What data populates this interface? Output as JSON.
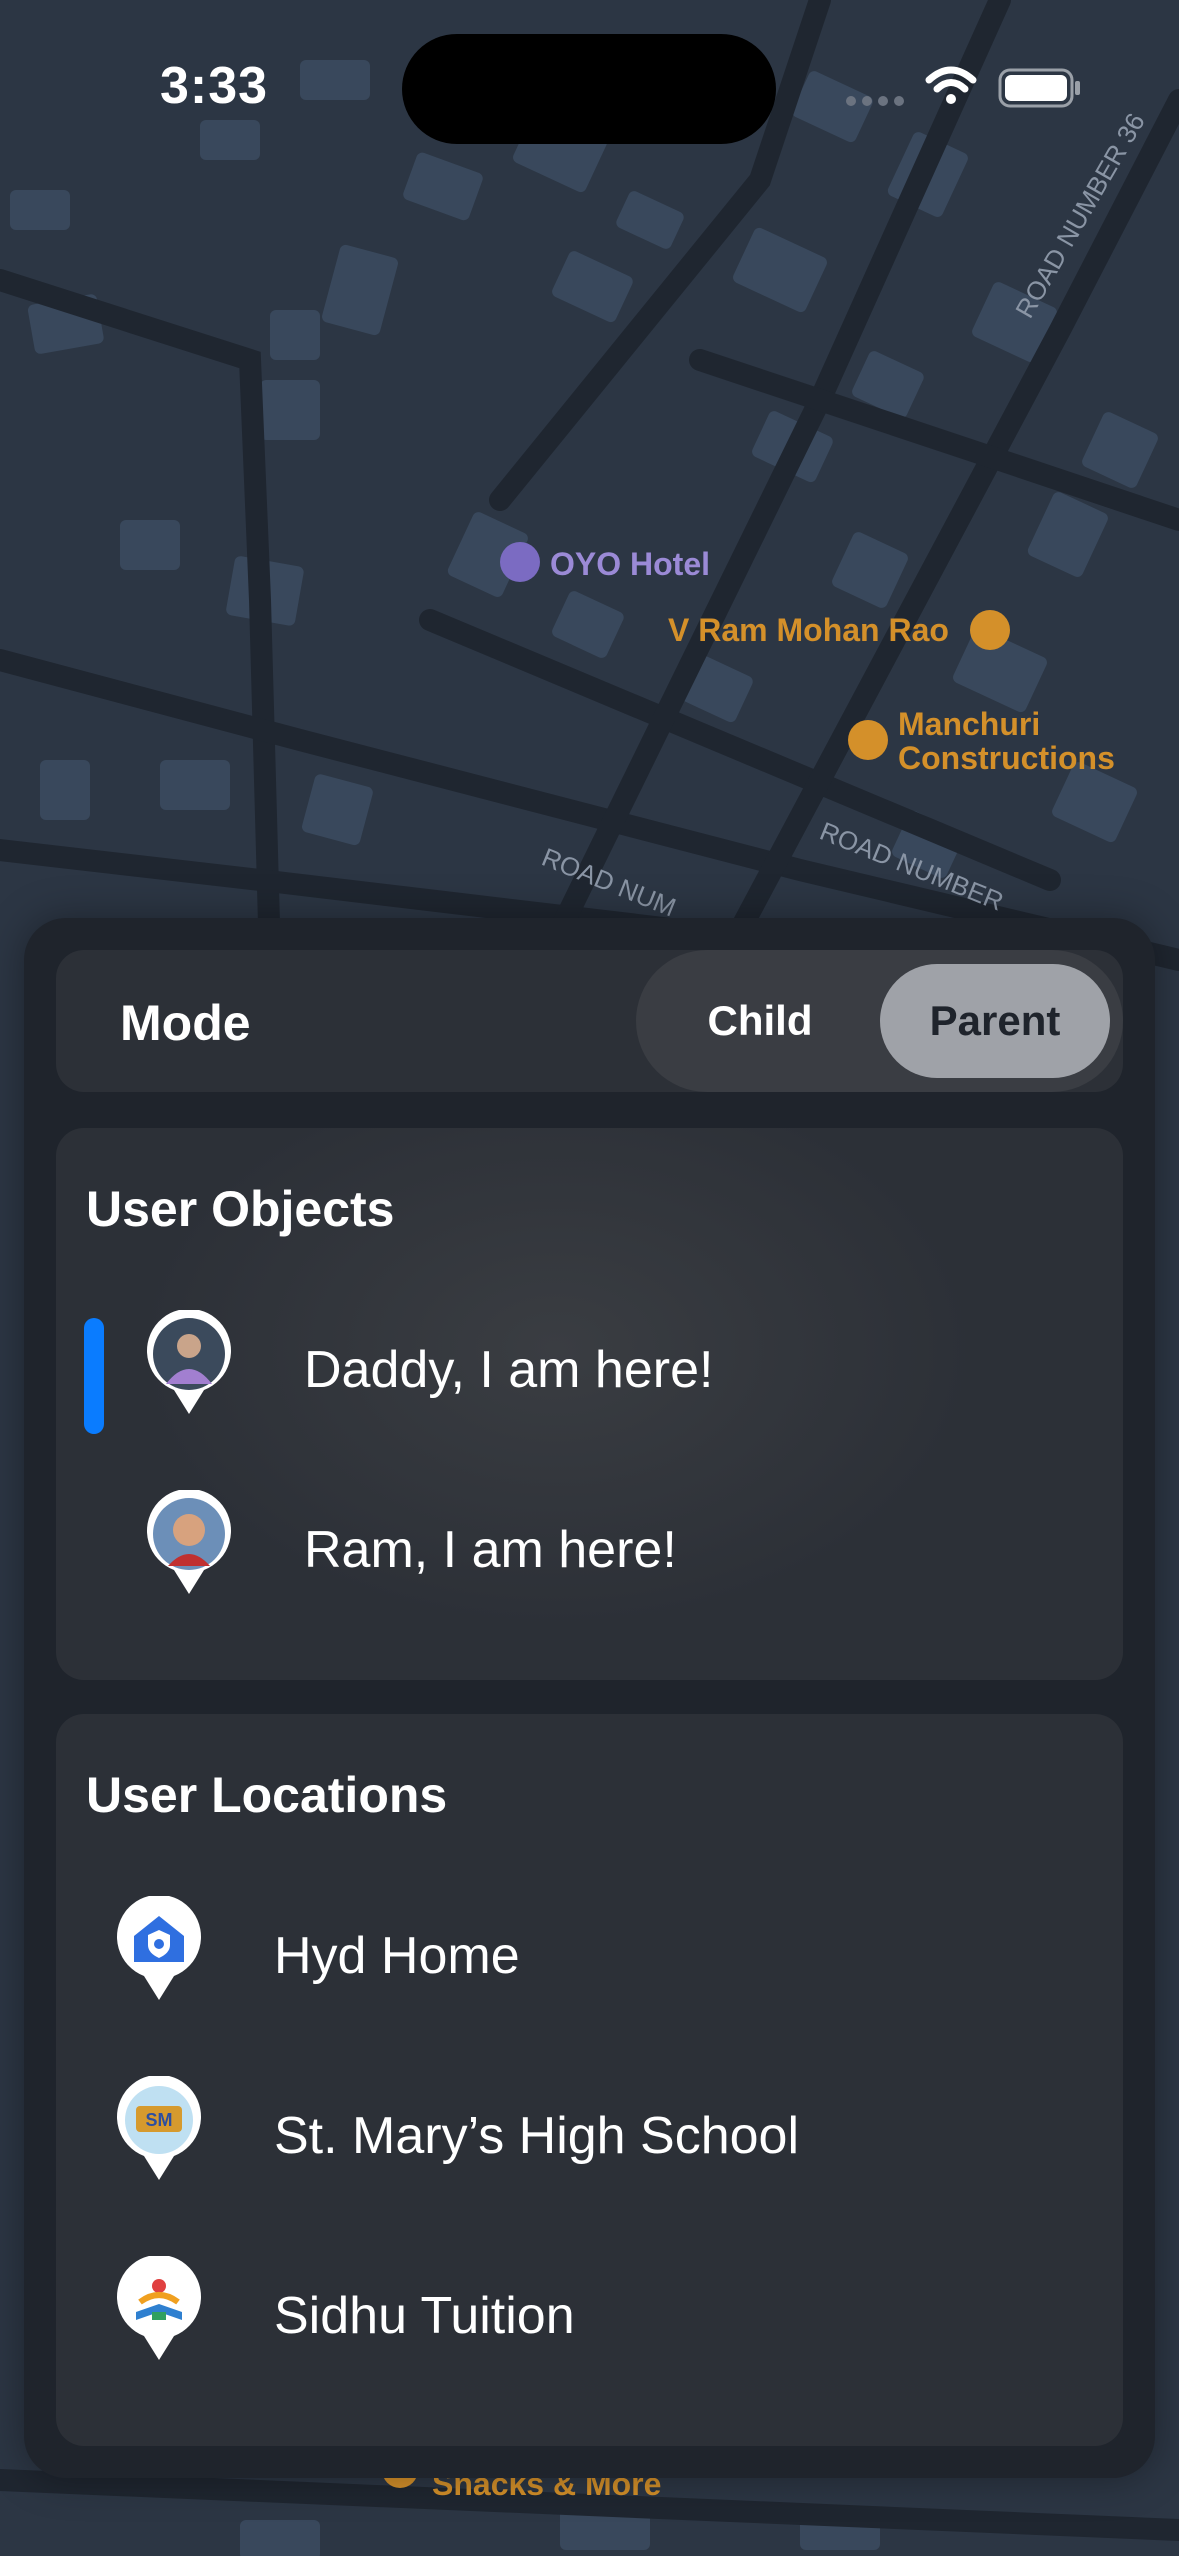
{
  "status_bar": {
    "time": "3:33"
  },
  "map_labels": {
    "oyo_hotel": "OYO Hotel",
    "ram_mohan": "V Ram Mohan Rao",
    "manchuri_1": "Manchuri",
    "manchuri_2": "Constructions",
    "road_36": "ROAD NUMBER 36",
    "road_num_a": "ROAD NUMBER",
    "road_num_b": "ROAD NUM",
    "snacks": "Snacks & More"
  },
  "mode": {
    "label": "Mode",
    "options": [
      "Child",
      "Parent"
    ],
    "selected": "Parent"
  },
  "user_objects": {
    "title": "User Objects",
    "items": [
      {
        "label": "Daddy, I am here!",
        "selected": true
      },
      {
        "label": "Ram, I am here!",
        "selected": false
      }
    ]
  },
  "user_locations": {
    "title": "User Locations",
    "items": [
      {
        "label": "Hyd Home",
        "icon": "home-shield-icon"
      },
      {
        "label": "St. Mary’s High School",
        "icon": "school-logo-icon"
      },
      {
        "label": "Sidhu Tuition",
        "icon": "tuition-logo-icon"
      }
    ]
  },
  "colors": {
    "accent": "#0a7cff",
    "map_bg": "#2c3644",
    "poi_orange": "#d4902a",
    "poi_purple": "#9b8ad6"
  }
}
